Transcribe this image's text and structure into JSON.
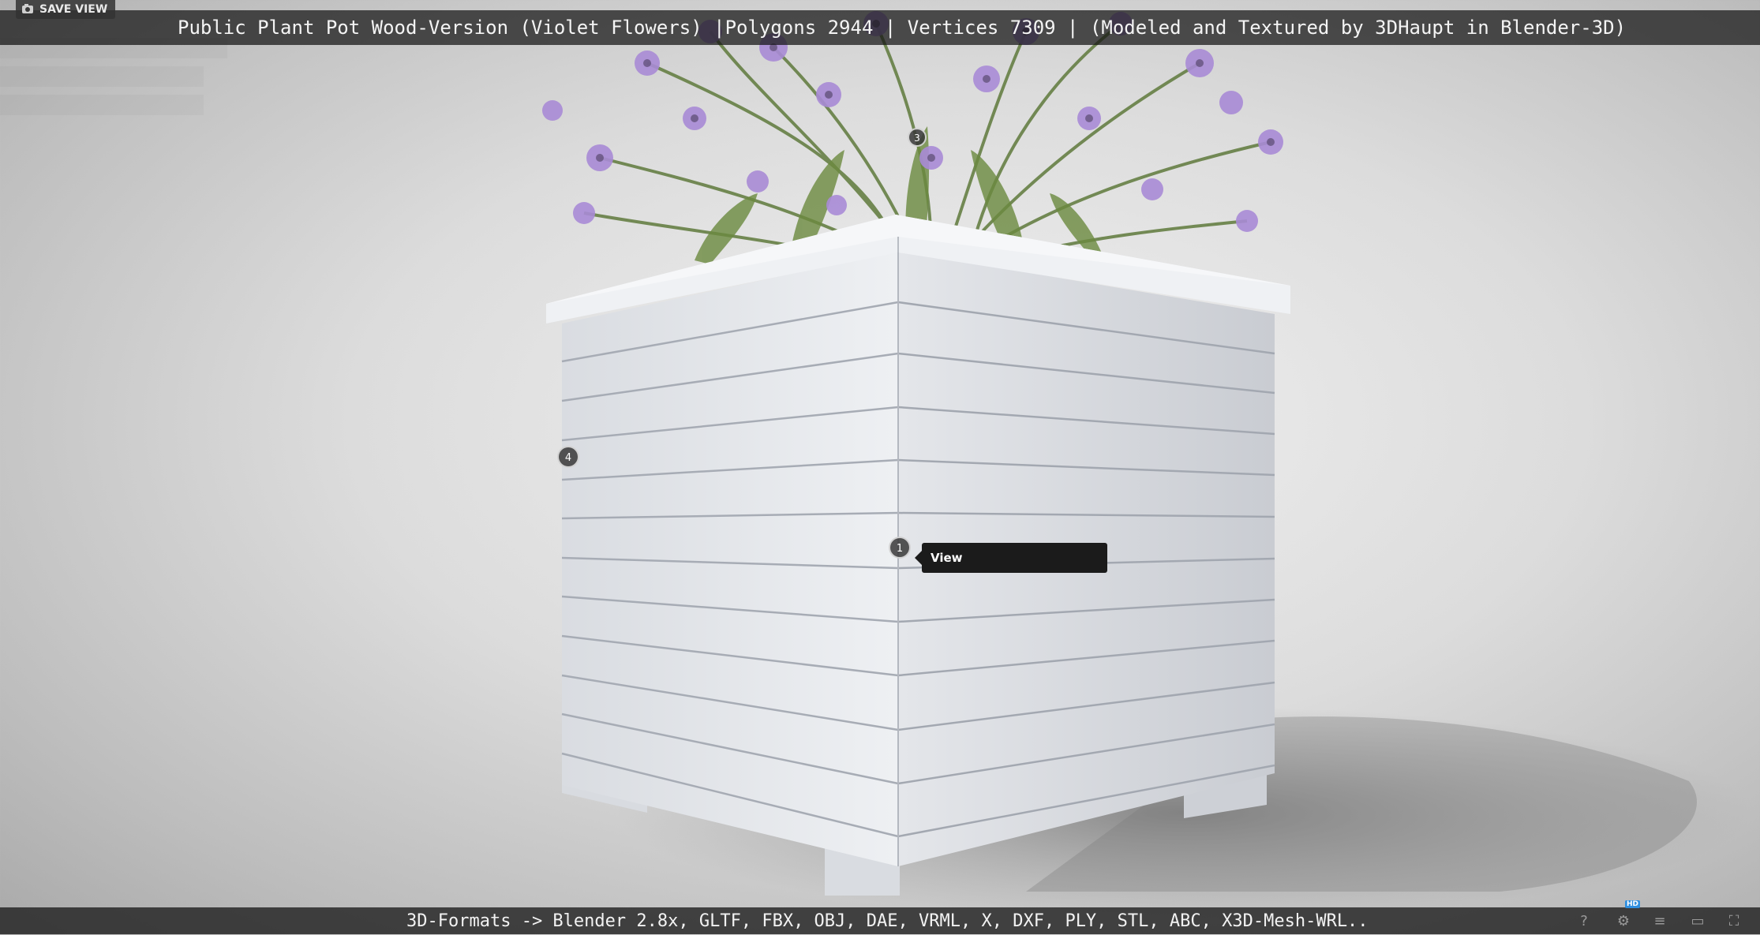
{
  "viewer": {
    "save_view_label": "SAVE VIEW",
    "title": "Public Plant Pot Wood-Version (Violet Flowers) |Polygons 2944 | Vertices 7309 | (Modeled and Textured by 3DHaupt in Blender-3D)",
    "formats_caption": "3D-Formats -> Blender 2.8x, GLTF, FBX, OBJ, DAE, VRML, X, DXF, PLY, STL, ABC, X3D-Mesh-WRL..",
    "tooltip_label": "View"
  },
  "hotspots": [
    {
      "number": "1"
    },
    {
      "number": "3"
    },
    {
      "number": "4"
    }
  ],
  "icons": {
    "save_view": "camera-icon",
    "help": "help-icon",
    "settings": "gear-icon",
    "layers": "layers-icon",
    "vr": "vr-headset-icon",
    "fullscreen": "fullscreen-icon"
  },
  "colors": {
    "title_bar": "#141414",
    "tooltip": "#1b1b1b",
    "flower": "#a98bd6",
    "planter_wood": "#e6e8ec",
    "hd_badge": "#2f8fe0"
  },
  "badges": {
    "hd": "HD"
  }
}
